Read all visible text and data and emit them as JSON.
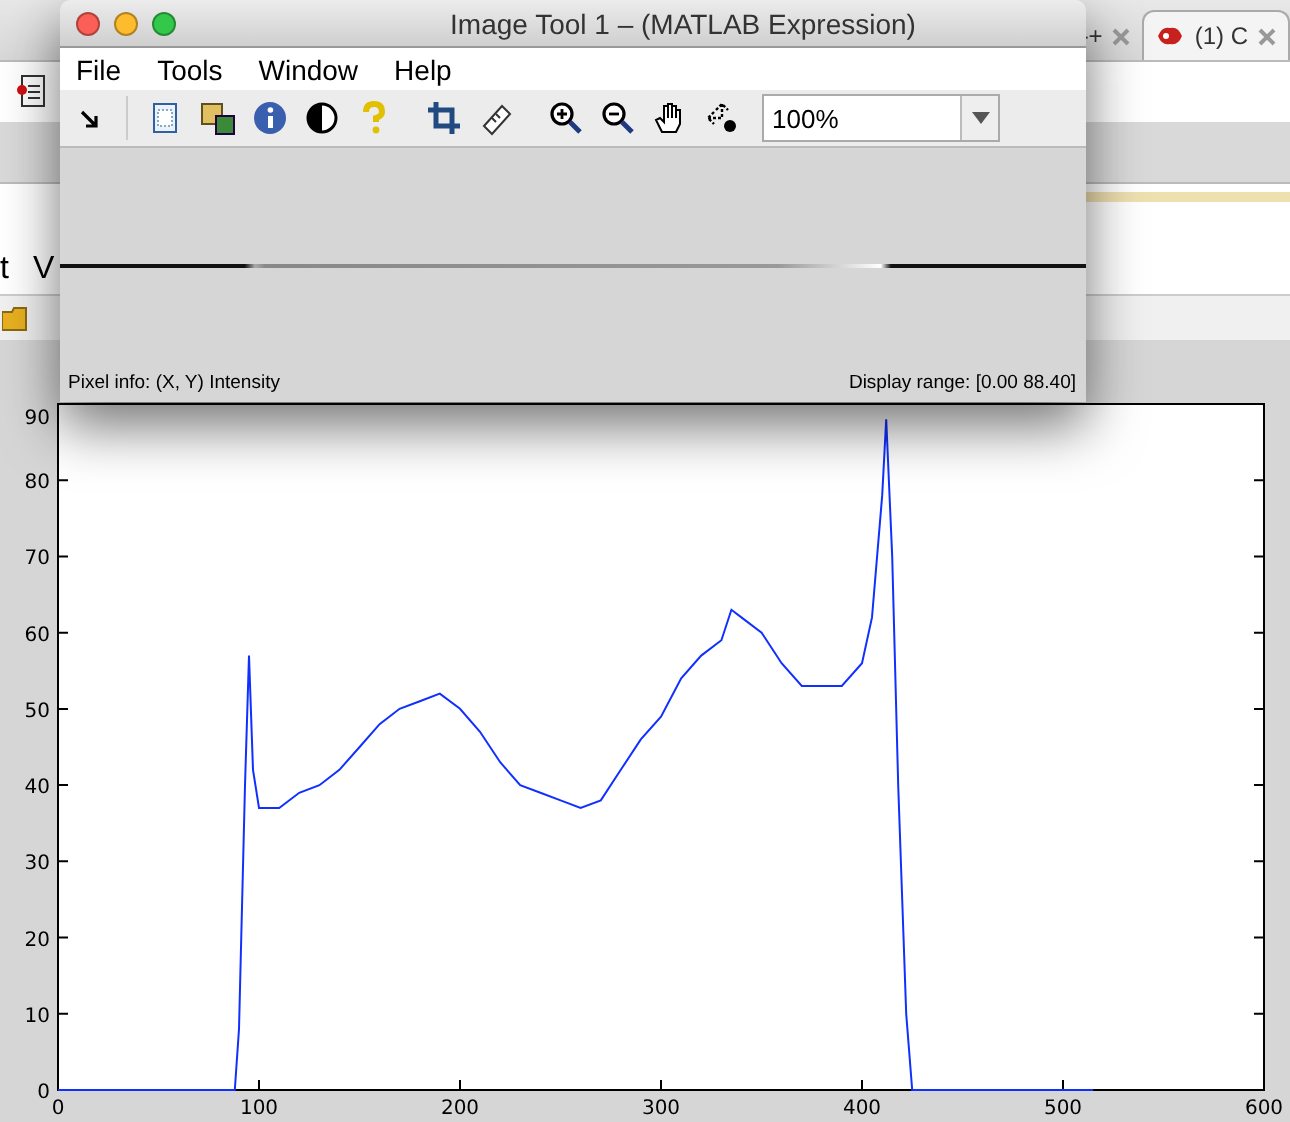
{
  "background_window": {
    "tabs": [
      {
        "label": "-+",
        "selected": false
      },
      {
        "label": "(1) C",
        "selected": true
      }
    ],
    "menu_fragments": [
      "t",
      "V"
    ]
  },
  "window": {
    "title": "Image Tool 1 – (MATLAB Expression)",
    "menus": [
      "File",
      "Tools",
      "Window",
      "Help"
    ],
    "zoom": {
      "value": "100%"
    },
    "status_left": "Pixel info: (X, Y)  Intensity",
    "status_right": "Display range: [0.00 88.40]"
  },
  "plot": {
    "chart_data": {
      "type": "line",
      "x": [
        0,
        88,
        90,
        93,
        95,
        97,
        100,
        110,
        120,
        130,
        140,
        150,
        160,
        170,
        180,
        190,
        200,
        210,
        220,
        230,
        240,
        250,
        260,
        270,
        280,
        290,
        300,
        310,
        320,
        330,
        335,
        340,
        350,
        360,
        370,
        380,
        390,
        400,
        405,
        410,
        412,
        415,
        418,
        422,
        425,
        450,
        515
      ],
      "series": [
        {
          "color": "#1030ff",
          "values": [
            0,
            0,
            8,
            40,
            57,
            42,
            37,
            37,
            39,
            40,
            42,
            45,
            48,
            50,
            51,
            52,
            50,
            47,
            43,
            40,
            39,
            38,
            37,
            38,
            42,
            46,
            49,
            54,
            57,
            59,
            63,
            62,
            60,
            56,
            53,
            53,
            53,
            56,
            62,
            78,
            88,
            70,
            40,
            10,
            0,
            0,
            0
          ]
        }
      ],
      "xlim": [
        0,
        600
      ],
      "ylim": [
        0,
        90
      ],
      "xticks": [
        0,
        100,
        200,
        300,
        400,
        500,
        600
      ],
      "yticks": [
        0,
        10,
        20,
        30,
        40,
        50,
        60,
        70,
        80,
        90
      ]
    }
  }
}
